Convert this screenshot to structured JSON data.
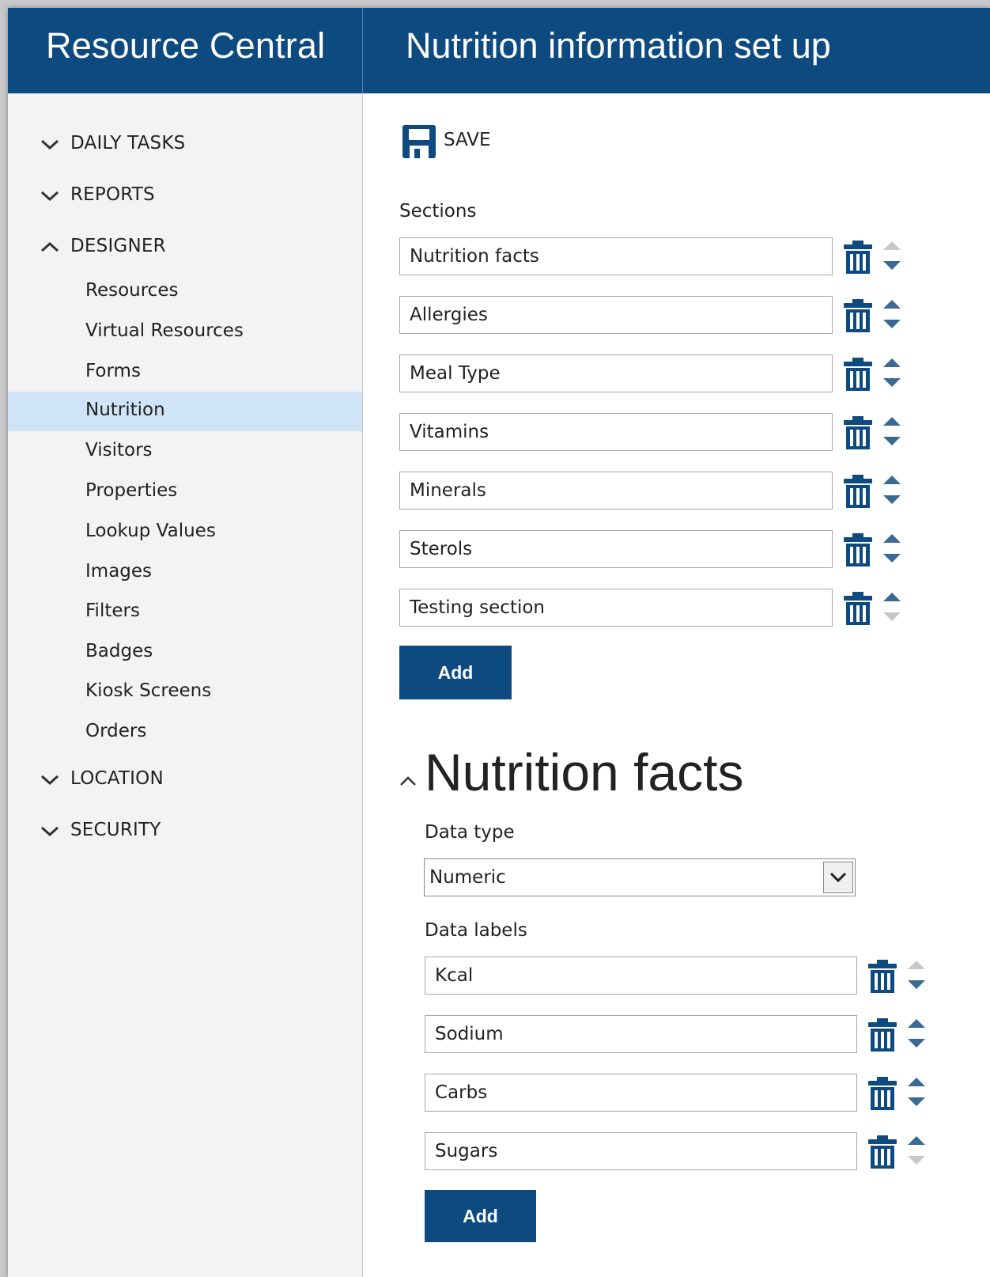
{
  "header": {
    "app_title": "Resource Central",
    "page_title": "Nutrition information set up"
  },
  "sidebar": {
    "groups": [
      {
        "label": "DAILY TASKS",
        "expanded": false
      },
      {
        "label": "REPORTS",
        "expanded": false
      },
      {
        "label": "DESIGNER",
        "expanded": true
      },
      {
        "label": "LOCATION",
        "expanded": false
      },
      {
        "label": "SECURITY",
        "expanded": false
      }
    ],
    "designer_items": [
      "Resources",
      "Virtual Resources",
      "Forms",
      "Nutrition",
      "Visitors",
      "Properties",
      "Lookup Values",
      "Images",
      "Filters",
      "Badges",
      "Kiosk Screens",
      "Orders"
    ],
    "active_item": "Nutrition"
  },
  "toolbar": {
    "save_label": "SAVE"
  },
  "sections": {
    "label": "Sections",
    "items": [
      {
        "value": "Nutrition facts"
      },
      {
        "value": "Allergies"
      },
      {
        "value": "Meal Type"
      },
      {
        "value": "Vitamins"
      },
      {
        "value": "Minerals"
      },
      {
        "value": "Sterols"
      },
      {
        "value": "Testing section"
      }
    ],
    "add_label": "Add"
  },
  "detail": {
    "title": "Nutrition facts",
    "data_type_label": "Data type",
    "data_type_value": "Numeric",
    "data_labels_label": "Data labels",
    "labels": [
      {
        "value": "Kcal"
      },
      {
        "value": "Sodium"
      },
      {
        "value": "Carbs"
      },
      {
        "value": "Sugars"
      }
    ],
    "add_label": "Add"
  },
  "colors": {
    "brand": "#0d4a80",
    "active_bg": "#cfe5f7",
    "arrow_active": "#3a6a94",
    "arrow_disabled": "#c8c8c8"
  }
}
